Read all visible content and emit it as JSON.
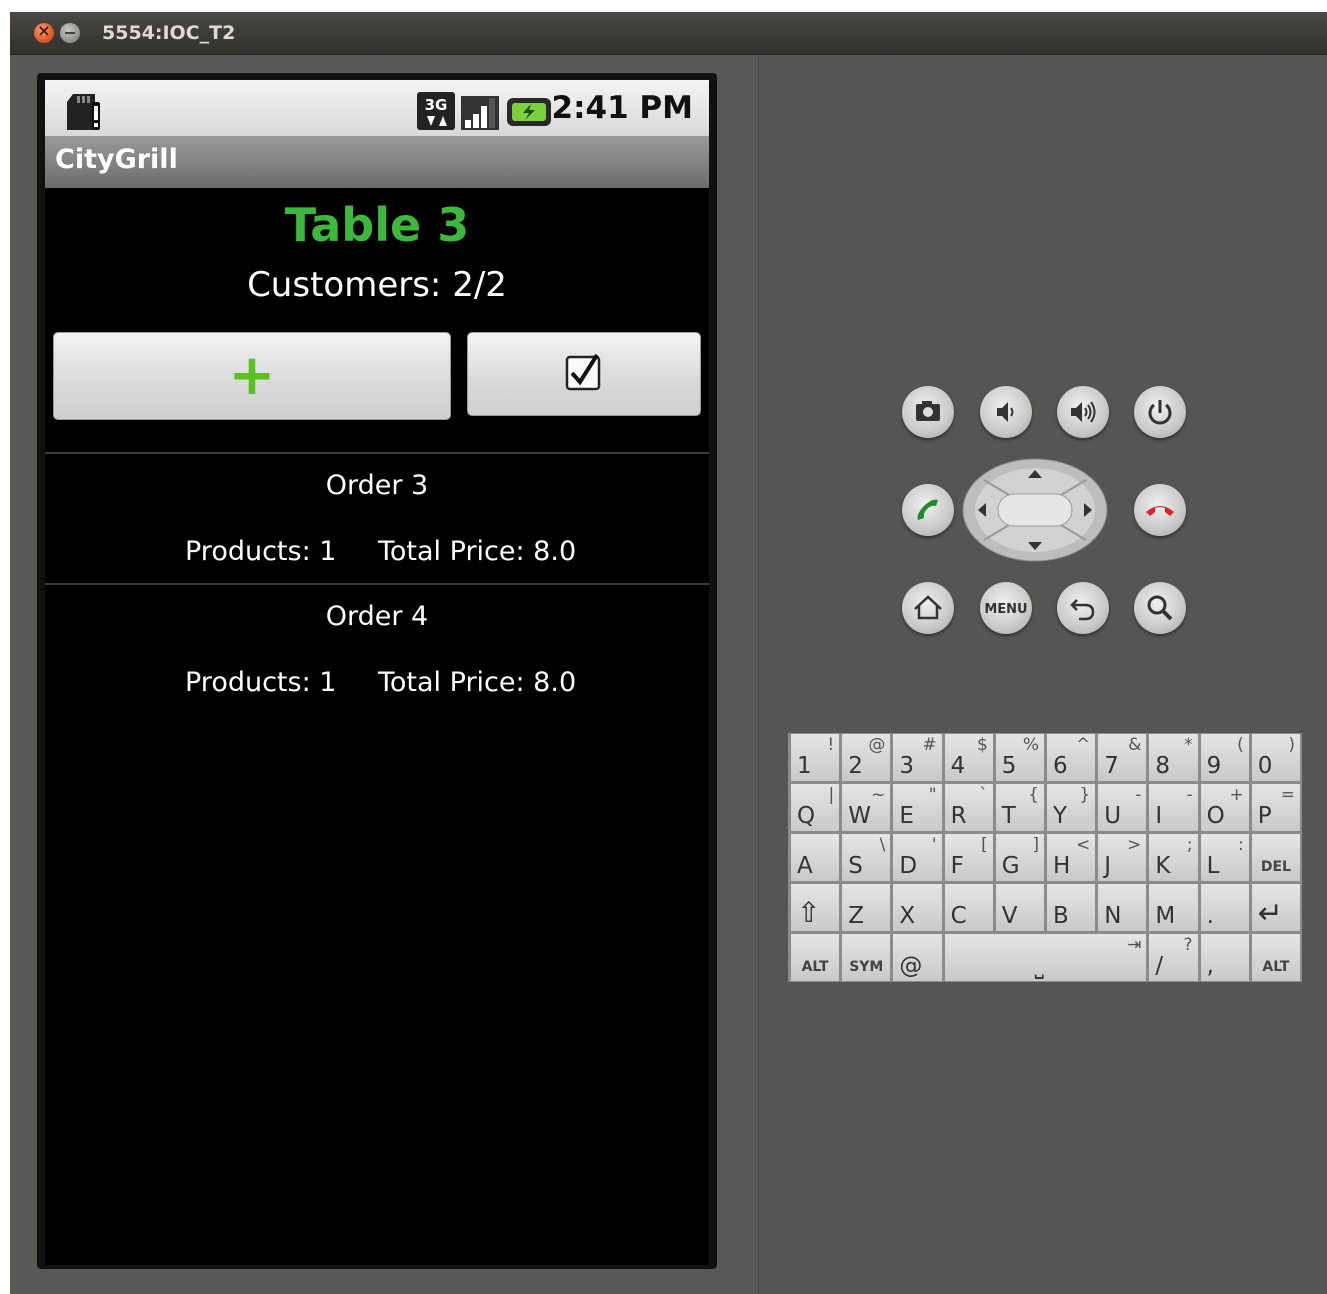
{
  "window": {
    "title": "5554:IOC_T2"
  },
  "status_bar": {
    "time": "2:41 PM",
    "network": "3G"
  },
  "app": {
    "title": "CityGrill",
    "table_title": "Table 3",
    "customers": "Customers: 2/2",
    "add_button": "+",
    "confirm_icon": "checkbox-icon",
    "orders": [
      {
        "title": "Order 3",
        "products": "Products: 1",
        "total": "Total Price: 8.0"
      },
      {
        "title": "Order 4",
        "products": "Products: 1",
        "total": "Total Price: 8.0"
      }
    ]
  },
  "hardware_buttons": {
    "row1": [
      "camera-icon",
      "volume-down-icon",
      "volume-up-icon",
      "power-icon"
    ],
    "row2": [
      "call-icon",
      "dpad-icon",
      "end-call-icon"
    ],
    "row3": [
      "home-icon",
      "menu-icon",
      "back-icon",
      "search-icon"
    ],
    "menu_label": "MENU"
  },
  "keyboard": {
    "rows": [
      [
        [
          "1",
          "!"
        ],
        [
          "2",
          "@"
        ],
        [
          "3",
          "#"
        ],
        [
          "4",
          "$"
        ],
        [
          "5",
          "%"
        ],
        [
          "6",
          "^"
        ],
        [
          "7",
          "&"
        ],
        [
          "8",
          "*"
        ],
        [
          "9",
          "("
        ],
        [
          "0",
          ")"
        ]
      ],
      [
        [
          "Q",
          "|"
        ],
        [
          "W",
          "~"
        ],
        [
          "E",
          "\""
        ],
        [
          "R",
          "`"
        ],
        [
          "T",
          "{"
        ],
        [
          "Y",
          "}"
        ],
        [
          "U",
          "-"
        ],
        [
          "I",
          "-"
        ],
        [
          "O",
          "+"
        ],
        [
          "P",
          "="
        ]
      ],
      [
        [
          "A",
          ""
        ],
        [
          "S",
          "\\"
        ],
        [
          "D",
          "'"
        ],
        [
          "F",
          "["
        ],
        [
          "G",
          "]"
        ],
        [
          "H",
          "<"
        ],
        [
          "J",
          ">"
        ],
        [
          "K",
          ";"
        ],
        [
          "L",
          ":"
        ],
        [
          "DEL",
          ""
        ]
      ],
      [
        [
          "⇧",
          ""
        ],
        [
          "Z",
          ""
        ],
        [
          "X",
          ""
        ],
        [
          "C",
          ""
        ],
        [
          "V",
          ""
        ],
        [
          "B",
          ""
        ],
        [
          "N",
          ""
        ],
        [
          "M",
          ""
        ],
        [
          ".",
          ""
        ],
        [
          "↵",
          ""
        ]
      ],
      [
        [
          "ALT",
          ""
        ],
        [
          "SYM",
          ""
        ],
        [
          "@",
          ""
        ],
        [
          "␣",
          "⇥"
        ],
        [
          "/",
          "?"
        ],
        [
          ",",
          ""
        ],
        [
          "ALT",
          ""
        ]
      ]
    ]
  },
  "colors": {
    "table_title": "#3cb93c",
    "plus": "#59c221",
    "call": "#1f8a2a",
    "end_call": "#d9242a"
  }
}
